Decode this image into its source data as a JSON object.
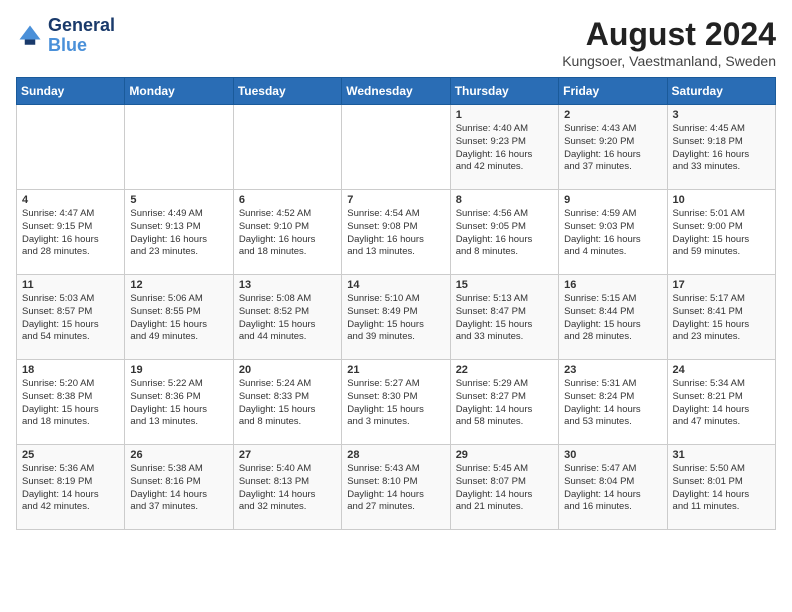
{
  "header": {
    "logo_line1": "General",
    "logo_line2": "Blue",
    "title": "August 2024",
    "subtitle": "Kungsoer, Vaestmanland, Sweden"
  },
  "days_of_week": [
    "Sunday",
    "Monday",
    "Tuesday",
    "Wednesday",
    "Thursday",
    "Friday",
    "Saturday"
  ],
  "weeks": [
    [
      {
        "day": "",
        "content": ""
      },
      {
        "day": "",
        "content": ""
      },
      {
        "day": "",
        "content": ""
      },
      {
        "day": "",
        "content": ""
      },
      {
        "day": "1",
        "content": "Sunrise: 4:40 AM\nSunset: 9:23 PM\nDaylight: 16 hours\nand 42 minutes."
      },
      {
        "day": "2",
        "content": "Sunrise: 4:43 AM\nSunset: 9:20 PM\nDaylight: 16 hours\nand 37 minutes."
      },
      {
        "day": "3",
        "content": "Sunrise: 4:45 AM\nSunset: 9:18 PM\nDaylight: 16 hours\nand 33 minutes."
      }
    ],
    [
      {
        "day": "4",
        "content": "Sunrise: 4:47 AM\nSunset: 9:15 PM\nDaylight: 16 hours\nand 28 minutes."
      },
      {
        "day": "5",
        "content": "Sunrise: 4:49 AM\nSunset: 9:13 PM\nDaylight: 16 hours\nand 23 minutes."
      },
      {
        "day": "6",
        "content": "Sunrise: 4:52 AM\nSunset: 9:10 PM\nDaylight: 16 hours\nand 18 minutes."
      },
      {
        "day": "7",
        "content": "Sunrise: 4:54 AM\nSunset: 9:08 PM\nDaylight: 16 hours\nand 13 minutes."
      },
      {
        "day": "8",
        "content": "Sunrise: 4:56 AM\nSunset: 9:05 PM\nDaylight: 16 hours\nand 8 minutes."
      },
      {
        "day": "9",
        "content": "Sunrise: 4:59 AM\nSunset: 9:03 PM\nDaylight: 16 hours\nand 4 minutes."
      },
      {
        "day": "10",
        "content": "Sunrise: 5:01 AM\nSunset: 9:00 PM\nDaylight: 15 hours\nand 59 minutes."
      }
    ],
    [
      {
        "day": "11",
        "content": "Sunrise: 5:03 AM\nSunset: 8:57 PM\nDaylight: 15 hours\nand 54 minutes."
      },
      {
        "day": "12",
        "content": "Sunrise: 5:06 AM\nSunset: 8:55 PM\nDaylight: 15 hours\nand 49 minutes."
      },
      {
        "day": "13",
        "content": "Sunrise: 5:08 AM\nSunset: 8:52 PM\nDaylight: 15 hours\nand 44 minutes."
      },
      {
        "day": "14",
        "content": "Sunrise: 5:10 AM\nSunset: 8:49 PM\nDaylight: 15 hours\nand 39 minutes."
      },
      {
        "day": "15",
        "content": "Sunrise: 5:13 AM\nSunset: 8:47 PM\nDaylight: 15 hours\nand 33 minutes."
      },
      {
        "day": "16",
        "content": "Sunrise: 5:15 AM\nSunset: 8:44 PM\nDaylight: 15 hours\nand 28 minutes."
      },
      {
        "day": "17",
        "content": "Sunrise: 5:17 AM\nSunset: 8:41 PM\nDaylight: 15 hours\nand 23 minutes."
      }
    ],
    [
      {
        "day": "18",
        "content": "Sunrise: 5:20 AM\nSunset: 8:38 PM\nDaylight: 15 hours\nand 18 minutes."
      },
      {
        "day": "19",
        "content": "Sunrise: 5:22 AM\nSunset: 8:36 PM\nDaylight: 15 hours\nand 13 minutes."
      },
      {
        "day": "20",
        "content": "Sunrise: 5:24 AM\nSunset: 8:33 PM\nDaylight: 15 hours\nand 8 minutes."
      },
      {
        "day": "21",
        "content": "Sunrise: 5:27 AM\nSunset: 8:30 PM\nDaylight: 15 hours\nand 3 minutes."
      },
      {
        "day": "22",
        "content": "Sunrise: 5:29 AM\nSunset: 8:27 PM\nDaylight: 14 hours\nand 58 minutes."
      },
      {
        "day": "23",
        "content": "Sunrise: 5:31 AM\nSunset: 8:24 PM\nDaylight: 14 hours\nand 53 minutes."
      },
      {
        "day": "24",
        "content": "Sunrise: 5:34 AM\nSunset: 8:21 PM\nDaylight: 14 hours\nand 47 minutes."
      }
    ],
    [
      {
        "day": "25",
        "content": "Sunrise: 5:36 AM\nSunset: 8:19 PM\nDaylight: 14 hours\nand 42 minutes."
      },
      {
        "day": "26",
        "content": "Sunrise: 5:38 AM\nSunset: 8:16 PM\nDaylight: 14 hours\nand 37 minutes."
      },
      {
        "day": "27",
        "content": "Sunrise: 5:40 AM\nSunset: 8:13 PM\nDaylight: 14 hours\nand 32 minutes."
      },
      {
        "day": "28",
        "content": "Sunrise: 5:43 AM\nSunset: 8:10 PM\nDaylight: 14 hours\nand 27 minutes."
      },
      {
        "day": "29",
        "content": "Sunrise: 5:45 AM\nSunset: 8:07 PM\nDaylight: 14 hours\nand 21 minutes."
      },
      {
        "day": "30",
        "content": "Sunrise: 5:47 AM\nSunset: 8:04 PM\nDaylight: 14 hours\nand 16 minutes."
      },
      {
        "day": "31",
        "content": "Sunrise: 5:50 AM\nSunset: 8:01 PM\nDaylight: 14 hours\nand 11 minutes."
      }
    ]
  ]
}
